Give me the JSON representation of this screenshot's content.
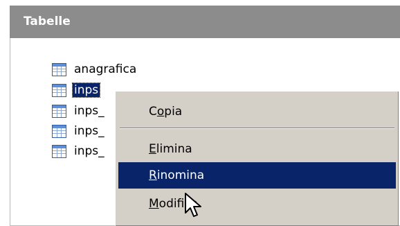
{
  "header": {
    "title": "Tabelle"
  },
  "tables": [
    {
      "name": "anagrafica",
      "icon": "table-icon",
      "selected": false
    },
    {
      "name": "inps",
      "icon": "table-icon",
      "selected": true
    },
    {
      "name": "inps_",
      "icon": "table-icon",
      "selected": false
    },
    {
      "name": "inps_",
      "icon": "table-icon",
      "selected": false
    },
    {
      "name": "inps_",
      "icon": "table-icon",
      "selected": false
    }
  ],
  "context_menu": {
    "items": [
      {
        "label": "Copia",
        "mnemonic_index": 1,
        "highlighted": false
      },
      {
        "label": "Elimina",
        "mnemonic_index": 0,
        "highlighted": false
      },
      {
        "label": "Rinomina",
        "mnemonic_index": 0,
        "highlighted": true
      },
      {
        "label": "Modifica",
        "mnemonic_index": 0,
        "highlighted": false
      }
    ]
  },
  "colors": {
    "header_bg": "#8c8c8c",
    "selection_bg": "#0a246a",
    "menu_bg": "#d4d0c8"
  },
  "cursor": {
    "icon": "arrow-cursor-icon"
  }
}
